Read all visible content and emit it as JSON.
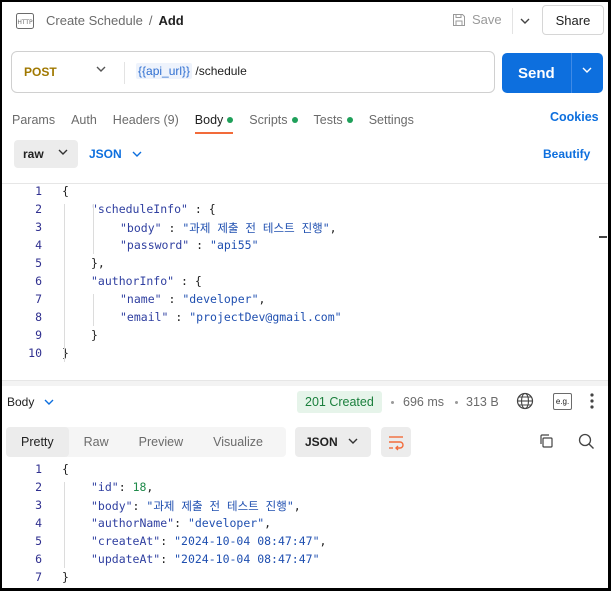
{
  "header": {
    "icon": "http-icon",
    "breadcrumb_parent": "Create Schedule",
    "breadcrumb_sep": "/",
    "breadcrumb_current": "Add",
    "save_label": "Save",
    "share_label": "Share"
  },
  "request": {
    "method": "POST",
    "url_var": "{{api_url}}",
    "url_path": " /schedule",
    "send_label": "Send"
  },
  "tabs": [
    {
      "label": "Params",
      "dot": false,
      "active": false
    },
    {
      "label": "Auth",
      "dot": false,
      "active": false
    },
    {
      "label": "Headers (9)",
      "dot": false,
      "active": false
    },
    {
      "label": "Body",
      "dot": true,
      "active": true
    },
    {
      "label": "Scripts",
      "dot": true,
      "active": false
    },
    {
      "label": "Tests",
      "dot": true,
      "active": false
    },
    {
      "label": "Settings",
      "dot": false,
      "active": false
    }
  ],
  "cookies_label": "Cookies",
  "body_toolbar": {
    "mode": "raw",
    "format": "JSON",
    "beautify_label": "Beautify"
  },
  "request_body": [
    {
      "num": "1",
      "tokens": [
        [
          "p",
          "{"
        ]
      ]
    },
    {
      "num": "2",
      "tokens": [
        [
          "k",
          "\"scheduleInfo\""
        ],
        [
          "p",
          " : {"
        ]
      ]
    },
    {
      "num": "3",
      "tokens": [
        [
          "k",
          "\"body\""
        ],
        [
          "p",
          " : "
        ],
        [
          "s",
          "\"과제 제출 전 테스트 진행\""
        ],
        [
          "p",
          ","
        ]
      ]
    },
    {
      "num": "4",
      "tokens": [
        [
          "k",
          "\"password\""
        ],
        [
          "p",
          " : "
        ],
        [
          "s",
          "\"api55\""
        ]
      ]
    },
    {
      "num": "5",
      "tokens": [
        [
          "p",
          "},"
        ]
      ]
    },
    {
      "num": "6",
      "tokens": [
        [
          "k",
          "\"authorInfo\""
        ],
        [
          "p",
          " : {"
        ]
      ]
    },
    {
      "num": "7",
      "tokens": [
        [
          "k",
          "\"name\""
        ],
        [
          "p",
          " : "
        ],
        [
          "s",
          "\"developer\""
        ],
        [
          "p",
          ","
        ]
      ]
    },
    {
      "num": "8",
      "tokens": [
        [
          "k",
          "\"email\""
        ],
        [
          "p",
          " : "
        ],
        [
          "s",
          "\"projectDev@gmail.com\""
        ]
      ]
    },
    {
      "num": "9",
      "tokens": [
        [
          "p",
          "}"
        ]
      ]
    },
    {
      "num": "10",
      "tokens": [
        [
          "p",
          "}"
        ]
      ]
    }
  ],
  "response": {
    "section_label": "Body",
    "status": "201 Created",
    "time": "696 ms",
    "size": "313 B",
    "eg_label": "e.g.",
    "view_tabs": [
      {
        "label": "Pretty",
        "active": true
      },
      {
        "label": "Raw",
        "active": false
      },
      {
        "label": "Preview",
        "active": false
      },
      {
        "label": "Visualize",
        "active": false
      }
    ],
    "format": "JSON"
  },
  "response_body": [
    {
      "num": "1",
      "tokens": [
        [
          "p",
          "{"
        ]
      ]
    },
    {
      "num": "2",
      "tokens": [
        [
          "k",
          "\"id\""
        ],
        [
          "p",
          ": "
        ],
        [
          "n",
          "18"
        ],
        [
          "p",
          ","
        ]
      ]
    },
    {
      "num": "3",
      "tokens": [
        [
          "k",
          "\"body\""
        ],
        [
          "p",
          ": "
        ],
        [
          "s",
          "\"과제 제출 전 테스트 진행\""
        ],
        [
          "p",
          ","
        ]
      ]
    },
    {
      "num": "4",
      "tokens": [
        [
          "k",
          "\"authorName\""
        ],
        [
          "p",
          ": "
        ],
        [
          "s",
          "\"developer\""
        ],
        [
          "p",
          ","
        ]
      ]
    },
    {
      "num": "5",
      "tokens": [
        [
          "k",
          "\"createAt\""
        ],
        [
          "p",
          ": "
        ],
        [
          "s",
          "\"2024-10-04 08:47:47\""
        ],
        [
          "p",
          ","
        ]
      ]
    },
    {
      "num": "6",
      "tokens": [
        [
          "k",
          "\"updateAt\""
        ],
        [
          "p",
          ": "
        ],
        [
          "s",
          "\"2024-10-04 08:47:47\""
        ]
      ]
    },
    {
      "num": "7",
      "tokens": [
        [
          "p",
          "}"
        ]
      ]
    }
  ],
  "colors": {
    "accent": "#0d6fde",
    "method": "#a07800",
    "status_ok": "#1a7f3c",
    "active_tab": "#f26b3a",
    "tab_dot": "#1fa05a"
  }
}
